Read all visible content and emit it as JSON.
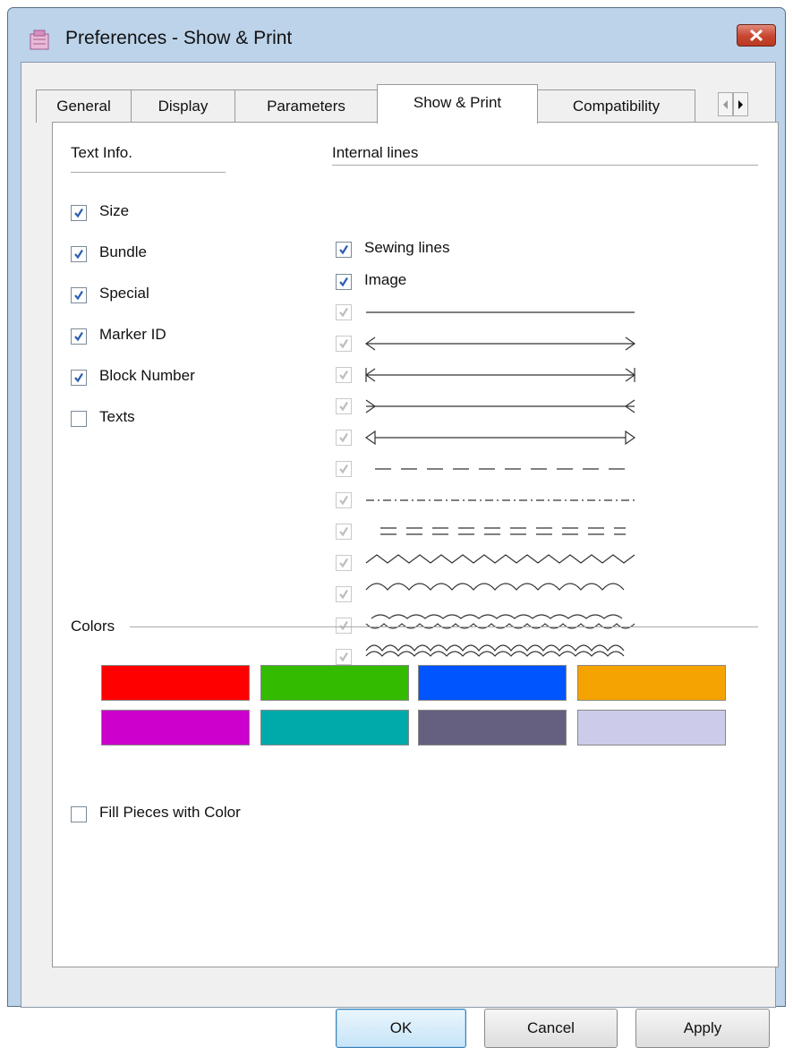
{
  "window": {
    "title": "Preferences - Show & Print",
    "icon": "app-icon"
  },
  "tabs": [
    {
      "label": "General",
      "active": false
    },
    {
      "label": "Display",
      "active": false
    },
    {
      "label": "Parameters",
      "active": false
    },
    {
      "label": "Show & Print",
      "active": true
    },
    {
      "label": "Compatibility",
      "active": false
    }
  ],
  "text_info": {
    "heading": "Text Info.",
    "items": [
      {
        "label": "Size",
        "checked": true
      },
      {
        "label": "Bundle",
        "checked": true
      },
      {
        "label": "Special",
        "checked": true
      },
      {
        "label": "Marker ID",
        "checked": true
      },
      {
        "label": "Block Number",
        "checked": true
      },
      {
        "label": "Texts",
        "checked": false
      }
    ]
  },
  "internal_lines": {
    "heading": "Internal lines",
    "items": [
      {
        "label": "Sewing lines",
        "checked": true
      },
      {
        "label": "Image",
        "checked": true
      }
    ],
    "line_styles": [
      "solid",
      "double-arrow",
      "barbed-arrow",
      "inward-arrow",
      "triangle-arrow",
      "long-dash",
      "dash-dot",
      "double-dash",
      "zigzag",
      "wave",
      "scallop",
      "loops"
    ]
  },
  "colors": {
    "heading": "Colors",
    "swatches": [
      "#ff0000",
      "#33bb00",
      "#0055ff",
      "#f5a300",
      "#cc00cc",
      "#00aaaa",
      "#666080",
      "#ccccea"
    ]
  },
  "fill_pieces": {
    "label": "Fill Pieces with Color",
    "checked": false
  },
  "buttons": {
    "ok": "OK",
    "cancel": "Cancel",
    "apply": "Apply"
  }
}
